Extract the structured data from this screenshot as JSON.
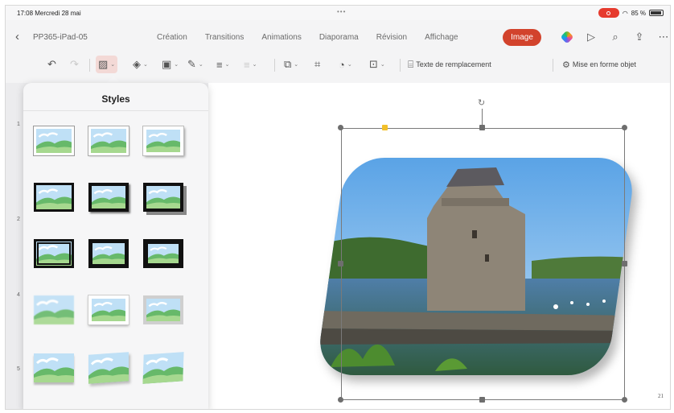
{
  "status_bar": {
    "time": "17:08  Mercredi 28 mai",
    "dots": "•••",
    "battery": "85 %"
  },
  "header": {
    "doc_title": "PP365-iPad-05",
    "tabs": [
      "Création",
      "Transitions",
      "Animations",
      "Diaporama",
      "Révision",
      "Affichage"
    ],
    "active_tab": "Image",
    "icons": [
      "copilot-icon",
      "play-icon",
      "search-icon",
      "share-icon",
      "more-icon"
    ]
  },
  "toolbar": {
    "alt_text_label": "Texte de remplacement",
    "format_label": "Mise en forme objet",
    "icons": [
      "undo-icon",
      "redo-icon",
      "picture-styles-icon",
      "picture-effects-icon",
      "picture-border-icon",
      "pen-icon",
      "align-icon",
      "spacing-icon",
      "arrange-icon",
      "crop-icon",
      "shape-icon",
      "replace-icon"
    ]
  },
  "styles_panel": {
    "title": "Styles",
    "styles": [
      "simple-frame-white",
      "soft-edge-rectangle",
      "shadow-rectangle",
      "thick-black-frame",
      "black-frame-shadow",
      "heavy-black-shadow",
      "double-frame-black",
      "thick-matte-black",
      "compound-frame-black",
      "soft-edge-blur",
      "white-bevel",
      "beveled-matte-gray",
      "reflected-rectangle",
      "perspective-shadow",
      "rotated-white"
    ]
  },
  "slide": {
    "number": "21",
    "ruler_marks": [
      "1",
      "2",
      "3",
      "4",
      "5"
    ]
  },
  "colors": {
    "accent": "#d2432c",
    "sky": "#a7cfee",
    "grass": "#6fbf6f",
    "frame": "#111111"
  }
}
